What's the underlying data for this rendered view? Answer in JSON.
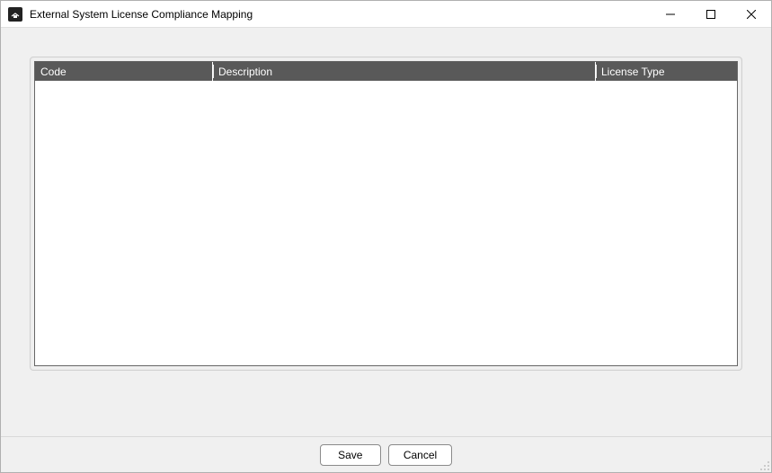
{
  "window": {
    "title": "External System License Compliance Mapping"
  },
  "table": {
    "columns": {
      "code": "Code",
      "description": "Description",
      "license_type": "License Type"
    },
    "rows": []
  },
  "buttons": {
    "save": "Save",
    "cancel": "Cancel"
  }
}
